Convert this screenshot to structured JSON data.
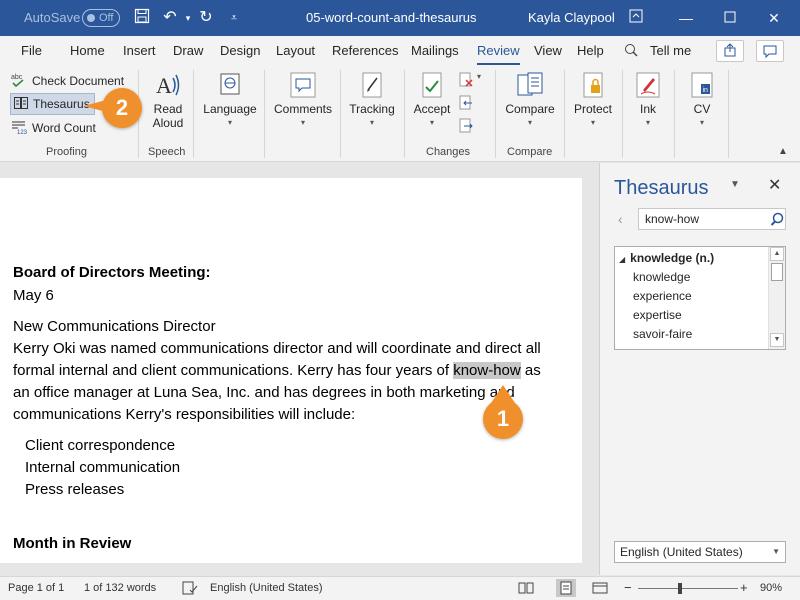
{
  "titlebar": {
    "autosave_label": "AutoSave",
    "autosave_state": "Off",
    "doc_title": "05-word-count-and-thesaurus",
    "user": "Kayla Claypool"
  },
  "tabs": [
    {
      "label": "File"
    },
    {
      "label": "Home"
    },
    {
      "label": "Insert"
    },
    {
      "label": "Draw"
    },
    {
      "label": "Design"
    },
    {
      "label": "Layout"
    },
    {
      "label": "References"
    },
    {
      "label": "Mailings"
    },
    {
      "label": "Review",
      "active": true
    },
    {
      "label": "View"
    },
    {
      "label": "Help"
    }
  ],
  "tell_me": "Tell me",
  "ribbon": {
    "proofing": {
      "check_document": "Check Document",
      "thesaurus": "Thesaurus",
      "word_count": "Word Count",
      "group": "Proofing"
    },
    "speech": {
      "read_aloud_1": "Read",
      "read_aloud_2": "Aloud",
      "group": "Speech"
    },
    "language": {
      "label": "Language"
    },
    "comments": {
      "label": "Comments"
    },
    "tracking": {
      "label": "Tracking"
    },
    "changes": {
      "accept": "Accept",
      "group": "Changes"
    },
    "compare": {
      "label": "Compare",
      "group": "Compare"
    },
    "protect": {
      "label": "Protect"
    },
    "ink": {
      "label": "Ink"
    },
    "cv": {
      "label": "CV"
    }
  },
  "document": {
    "lines": [
      "Board of Directors Meeting:",
      "May 6",
      "New Communications Director",
      "Kerry Oki was named communications director and will coordinate and direct all",
      "formal internal and client communications. Kerry has four years of ",
      "know-how",
      " as",
      "an office manager at Luna Sea, Inc. and has degrees in both marketing and",
      "communications Kerry's responsibilities will include:",
      "Client correspondence",
      "Internal communication",
      "Press releases",
      "Month in Review"
    ]
  },
  "thesaurus": {
    "title": "Thesaurus",
    "search_value": "know-how",
    "header": "knowledge (n.)",
    "items": [
      "knowledge",
      "experience",
      "expertise",
      "savoir-faire"
    ],
    "language": "English (United States)"
  },
  "status": {
    "page": "Page 1 of 1",
    "words": "1 of 132 words",
    "language": "English (United States)",
    "zoom": "90%"
  },
  "callouts": {
    "one": "1",
    "two": "2"
  },
  "colors": {
    "accent": "#2b579a",
    "callout": "#f0902c"
  }
}
